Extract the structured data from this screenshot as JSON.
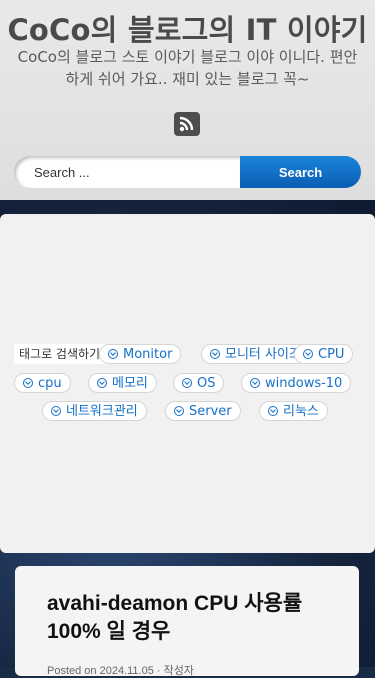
{
  "header": {
    "site_title": "CoCo의 블로그의 IT 이야기",
    "tagline": "CoCo의 블로그 스토 이야기 블로그 이야 이니다. 편안하게 쉬어 가요.. 재미 있는 블로그 꼭~",
    "rss_icon": "rss-icon"
  },
  "search": {
    "placeholder": "Search ...",
    "button_label": "Search"
  },
  "tags_widget": {
    "title": "태그로 검색하기",
    "tags": [
      {
        "label": "Monitor"
      },
      {
        "label": "모니터 사이즈"
      },
      {
        "label": "CPU"
      },
      {
        "label": "cpu"
      },
      {
        "label": "메모리"
      },
      {
        "label": "OS"
      },
      {
        "label": "windows-10"
      },
      {
        "label": "네트워크관리"
      },
      {
        "label": "Server"
      },
      {
        "label": "리눅스"
      }
    ]
  },
  "post": {
    "title": "avahi-deamon CPU 사용률 100% 일 경우",
    "meta": "Posted on 2024.11.05 · 작성자"
  },
  "colors": {
    "accent": "#0a6fcf",
    "tag_text": "#1670c8",
    "title_text": "#4a4a4a"
  }
}
